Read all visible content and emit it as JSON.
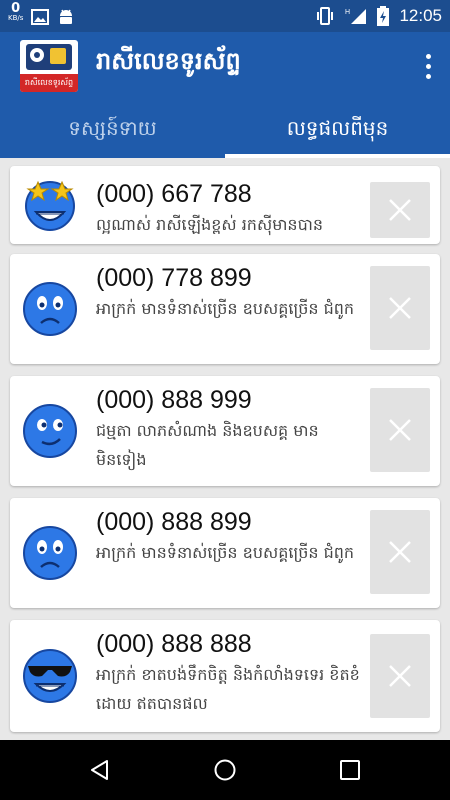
{
  "status": {
    "speed_value": "0",
    "speed_unit": "KB/s",
    "time": "12:05"
  },
  "app": {
    "title": "រាសីលេខទូរស័ព្ទ",
    "logo_text": "រាសីលេខទូរស័ព្ទ"
  },
  "tabs": [
    {
      "label": "ទស្សន៍ទាយ",
      "active": false
    },
    {
      "label": "លទ្ធផលពីមុន",
      "active": true
    }
  ],
  "results": [
    {
      "number": "(000) 667 788",
      "desc": "ល្អណាស់ រាសីឡើងខ្ពស់ រកស៊ីមានបាន",
      "emoji": "star-eyes-emoji-icon"
    },
    {
      "number": "(000) 778 899",
      "desc": "អាក្រក់ មានទំនាស់ច្រើន ឧបសគ្គច្រើន ជំពូក",
      "emoji": "worried-emoji-icon"
    },
    {
      "number": "(000) 888 999",
      "desc": "ជម្មតា លាភសំណាង និងឧបសគ្គ មានមិនទៀង",
      "emoji": "smirk-emoji-icon"
    },
    {
      "number": "(000) 888 899",
      "desc": "អាក្រក់ មានទំនាស់ច្រើន ឧបសគ្គច្រើន ជំពូក",
      "emoji": "worried-emoji-icon"
    },
    {
      "number": "(000) 888 888",
      "desc": "អាក្រក់ ខាតបង់ទឹកចិត្ត និងកំលាំងទទេរ ខិតខំដោយ ឥតបានផល",
      "emoji": "sunglasses-emoji-icon"
    }
  ],
  "colors": {
    "primary": "#1f5bab",
    "status_bar": "#1c4d8f",
    "background": "#e8e8e8",
    "delete_button": "#e2e2e2"
  }
}
